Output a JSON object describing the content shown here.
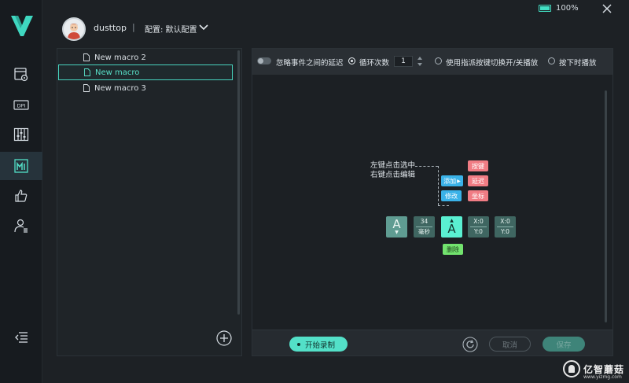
{
  "topbar": {
    "username": "dusttop",
    "separator": "|",
    "profile_label": "配置: 默认配置",
    "battery_level": 100,
    "battery_text": "100%"
  },
  "sidebar": {
    "items": [
      {
        "icon": "mouse-settings-icon"
      },
      {
        "icon": "dpi-icon",
        "label": "DPI"
      },
      {
        "icon": "equalizer-icon"
      },
      {
        "icon": "macro-icon",
        "active": true
      },
      {
        "icon": "thumbs-up-icon"
      },
      {
        "icon": "user-settings-icon"
      }
    ],
    "collapse_icon": "collapse-menu-icon"
  },
  "macros": {
    "items": [
      {
        "name": "New macro 2",
        "selected": false
      },
      {
        "name": "New macro",
        "selected": true
      },
      {
        "name": "New macro 3",
        "selected": false
      }
    ]
  },
  "editor": {
    "ignore_delay_label": "忽略事件之间的延迟",
    "loop_label": "循环次数",
    "loop_count": "1",
    "toggle_play_label": "使用指派按键切换开/关播放",
    "hold_play_label": "按下时播放",
    "hint_line1": "左键点击选中",
    "hint_line2": "右键点击编辑",
    "add_label": "添加",
    "edit_label": "修改",
    "key_label": "按键",
    "delay_label": "延迟",
    "coord_label": "坐标",
    "delete_label": "删除",
    "tiles": {
      "key1": "A",
      "delay_value": "34",
      "delay_unit": "毫秒",
      "key2": "A",
      "xy1_x": "X:0",
      "xy1_y": "Y:0",
      "xy2_x": "X:0",
      "xy2_y": "Y:0"
    },
    "record_label": "开始录制",
    "cancel_label": "取消",
    "save_label": "保存"
  },
  "watermark": {
    "text": "亿智蘑菇",
    "url": "www.yizmg.com"
  },
  "colors": {
    "accent": "#53e0c8",
    "background": "#1d2125",
    "red_button": "#f07c84",
    "blue_button": "#3ab2e8",
    "green_button": "#72e36e"
  }
}
